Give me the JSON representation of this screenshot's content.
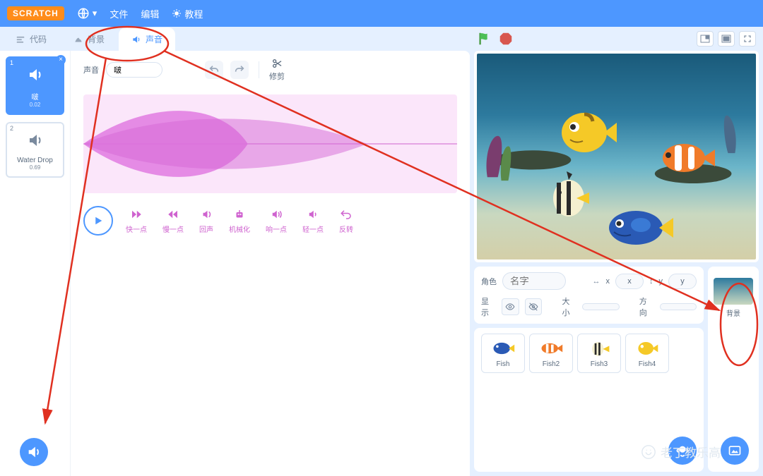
{
  "topbar": {
    "logo": "SCRATCH",
    "file": "文件",
    "edit": "编辑",
    "tutorials": "教程"
  },
  "tabs": {
    "code": "代码",
    "backdrops": "背景",
    "sounds": "声音"
  },
  "sounds": {
    "list": [
      {
        "name": "啵",
        "duration": "0.02"
      },
      {
        "name": "Water Drop",
        "duration": "0.69"
      }
    ],
    "name_label": "声音",
    "name_value": "啵",
    "trim": "修剪"
  },
  "effects": {
    "faster": "快一点",
    "slower": "慢一点",
    "echo": "回声",
    "robot": "机械化",
    "louder": "响一点",
    "softer": "轻一点",
    "reverse": "反转"
  },
  "spritepanel": {
    "sprite_label": "角色",
    "name_placeholder": "名字",
    "x_label": "x",
    "y_label": "y",
    "show_label": "显示",
    "size_label": "大小",
    "direction_label": "方向"
  },
  "sprites": [
    {
      "name": "Fish"
    },
    {
      "name": "Fish2"
    },
    {
      "name": "Fish3"
    },
    {
      "name": "Fish4"
    }
  ],
  "stagepanel": {
    "label": "背景"
  },
  "watermark": "老丁教乐高"
}
